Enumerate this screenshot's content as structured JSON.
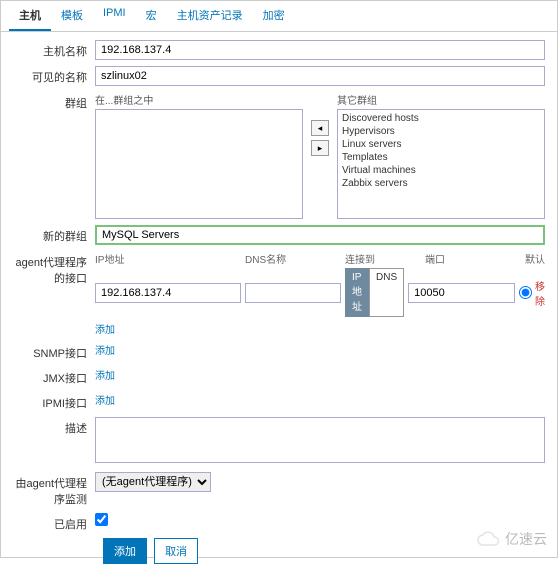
{
  "tabs": [
    "主机",
    "模板",
    "IPMI",
    "宏",
    "主机资产记录",
    "加密"
  ],
  "labels": {
    "hostname": "主机名称",
    "visiblename": "可见的名称",
    "groups": "群组",
    "ingroups": "在...群组之中",
    "othergroups": "其它群组",
    "newgroup": "新的群组",
    "agent": "agent代理程序的接口",
    "snmp": "SNMP接口",
    "jmx": "JMX接口",
    "ipmi": "IPMI接口",
    "desc": "描述",
    "monitored": "由agent代理程序监测",
    "enabled": "已启用"
  },
  "values": {
    "hostname": "192.168.137.4",
    "visiblename": "szlinux02",
    "newgroup": "MySQL Servers",
    "ip": "192.168.137.4",
    "port": "10050",
    "monitored_opt": "(无agent代理程序)"
  },
  "iface_headers": {
    "ip": "IP地址",
    "dns": "DNS名称",
    "connect": "连接到",
    "port": "端口",
    "default": "默认"
  },
  "connect_btns": {
    "ip": "IP地址",
    "dns": "DNS"
  },
  "other_groups": [
    "Discovered hosts",
    "Hypervisors",
    "Linux servers",
    "Templates",
    "Virtual machines",
    "Zabbix servers"
  ],
  "links": {
    "add": "添加",
    "remove": "移除",
    "cancel": "取消"
  },
  "watermark": "亿速云"
}
